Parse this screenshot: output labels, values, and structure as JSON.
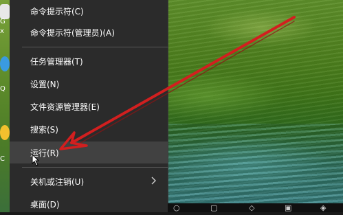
{
  "desktop": {
    "icon_letters": [
      "G",
      "x",
      "Q",
      "C"
    ]
  },
  "context_menu": {
    "items": [
      {
        "label": "命令提示符(C)"
      },
      {
        "label": "命令提示符(管理员)(A)"
      },
      {
        "label": "任务管理器(T)"
      },
      {
        "label": "设置(N)"
      },
      {
        "label": "文件资源管理器(E)"
      },
      {
        "label": "搜索(S)"
      },
      {
        "label": "运行(R)",
        "highlighted": true
      },
      {
        "label": "关机或注销(U)",
        "has_submenu": true
      },
      {
        "label": "桌面(D)"
      }
    ]
  },
  "annotation": {
    "arrow_color": "#d21f1f"
  },
  "colors": {
    "menu_bg": "#2b2b2b",
    "menu_highlight": "#414141",
    "menu_text": "#ffffff"
  }
}
